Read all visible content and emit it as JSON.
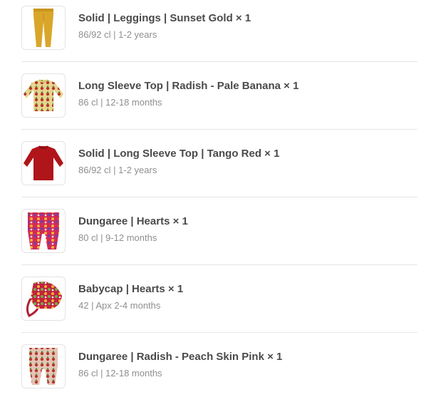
{
  "items": [
    {
      "title": "Solid | Leggings | Sunset Gold × 1",
      "variant": "86/92 cl | 1-2 years",
      "image_icon": "leggings-icon",
      "color": "#d9a62a"
    },
    {
      "title": "Long Sleeve Top | Radish - Pale Banana × 1",
      "variant": "86 cl | 12-18 months",
      "image_icon": "long-sleeve-top-icon",
      "color": "#b6a15a"
    },
    {
      "title": "Solid | Long Sleeve Top | Tango Red × 1",
      "variant": "86/92 cl | 1-2 years",
      "image_icon": "long-sleeve-top-icon",
      "color": "#b0151a"
    },
    {
      "title": "Dungaree | Hearts × 1",
      "variant": "80 cl | 9-12 months",
      "image_icon": "dungaree-icon",
      "color": "#d42b56"
    },
    {
      "title": "Babycap | Hearts × 1",
      "variant": "42 | Apx 2-4 months",
      "image_icon": "babycap-icon",
      "color": "#c1233f"
    },
    {
      "title": "Dungaree | Radish - Peach Skin Pink × 1",
      "variant": "86 cl | 12-18 months",
      "image_icon": "dungaree-icon",
      "color": "#b98a7e"
    }
  ]
}
